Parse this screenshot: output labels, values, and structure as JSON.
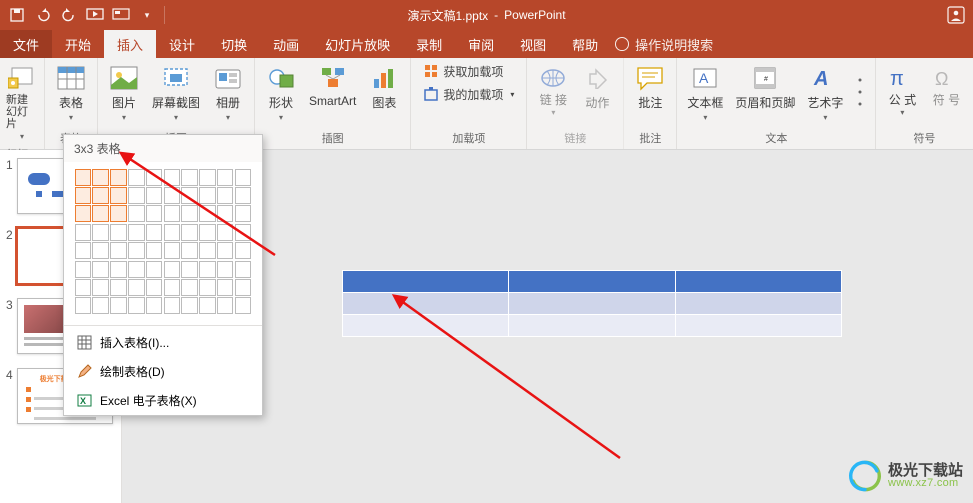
{
  "app": {
    "title_doc": "演示文稿1.pptx",
    "title_app": "PowerPoint"
  },
  "menu": {
    "file": "文件",
    "home": "开始",
    "insert": "插入",
    "design": "设计",
    "transitions": "切换",
    "animations": "动画",
    "slideshow": "幻灯片放映",
    "record": "录制",
    "review": "审阅",
    "view": "视图",
    "help": "帮助",
    "tell_me": "操作说明搜索"
  },
  "ribbon": {
    "new_slide": "新建\n幻灯片",
    "slides_group": "幻灯片",
    "table": "表格",
    "pictures": "图片",
    "screenshot": "屏幕截图",
    "album": "相册",
    "illustrations_group": "插图",
    "shapes": "形状",
    "smartart": "SmartArt",
    "chart": "图表",
    "get_addins": "获取加载项",
    "my_addins": "我的加载项",
    "addins_group": "加载项",
    "link": "链\n接",
    "action": "动作",
    "links_group": "链接",
    "comment": "批注",
    "comments_group": "批注",
    "textbox": "文本框",
    "header_footer": "页眉和页脚",
    "wordart": "艺术字",
    "text_group": "文本",
    "equation": "公\n式",
    "symbol": "符\n号",
    "symbols_group": "符号"
  },
  "table_dd": {
    "title": "3x3 表格",
    "insert_table": "插入表格(I)...",
    "draw_table": "绘制表格(D)",
    "excel": "Excel 电子表格(X)",
    "sel_rows": 3,
    "sel_cols": 3
  },
  "slides": {
    "n1": "1",
    "n2": "2",
    "n3": "3",
    "n4": "4"
  },
  "chart_data": {
    "type": "table",
    "rows": 3,
    "cols": 3,
    "col_widths_equal": true,
    "row_styles": [
      "header",
      "band-light",
      "band-lighter"
    ],
    "colors": {
      "header": "#4472c4",
      "band1": "#cfd5ea",
      "band2": "#e9ebf5"
    },
    "cells": [
      [
        "",
        "",
        ""
      ],
      [
        "",
        "",
        ""
      ],
      [
        "",
        "",
        ""
      ]
    ]
  },
  "watermark": {
    "name": "极光下载站",
    "url": "www.xz7.com"
  }
}
